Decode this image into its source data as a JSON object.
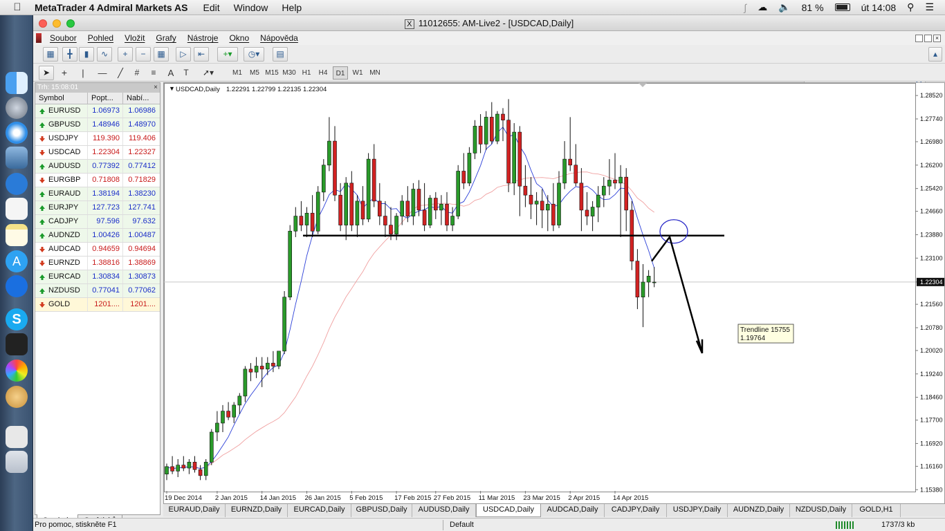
{
  "os_menubar": {
    "app": "MetaTrader 4 Admiral Markets AS",
    "menus": [
      "Edit",
      "Window",
      "Help"
    ],
    "battery": "81 %",
    "clock": "út 14:08"
  },
  "window": {
    "title": "11012655: AM-Live2 - [USDCAD,Daily]"
  },
  "menu": [
    "Soubor",
    "Pohled",
    "Vložit",
    "Grafy",
    "Nástroje",
    "Okno",
    "Nápověda"
  ],
  "timeframes": [
    "M1",
    "M5",
    "M15",
    "M30",
    "H1",
    "H4",
    "D1",
    "W1",
    "MN"
  ],
  "active_timeframe": "D1",
  "market_watch": {
    "header": "Trh: 15:08:01",
    "columns": [
      "Symbol",
      "Popt...",
      "Nabí..."
    ],
    "rows": [
      {
        "symbol": "EURUSD",
        "bid": "1.06973",
        "ask": "1.06986",
        "dir": "up"
      },
      {
        "symbol": "GBPUSD",
        "bid": "1.48946",
        "ask": "1.48970",
        "dir": "up"
      },
      {
        "symbol": "USDJPY",
        "bid": "119.390",
        "ask": "119.406",
        "dir": "down"
      },
      {
        "symbol": "USDCAD",
        "bid": "1.22304",
        "ask": "1.22327",
        "dir": "down"
      },
      {
        "symbol": "AUDUSD",
        "bid": "0.77392",
        "ask": "0.77412",
        "dir": "up"
      },
      {
        "symbol": "EURGBP",
        "bid": "0.71808",
        "ask": "0.71829",
        "dir": "down"
      },
      {
        "symbol": "EURAUD",
        "bid": "1.38194",
        "ask": "1.38230",
        "dir": "up"
      },
      {
        "symbol": "EURJPY",
        "bid": "127.723",
        "ask": "127.741",
        "dir": "up"
      },
      {
        "symbol": "CADJPY",
        "bid": "97.596",
        "ask": "97.632",
        "dir": "up"
      },
      {
        "symbol": "AUDNZD",
        "bid": "1.00426",
        "ask": "1.00487",
        "dir": "up"
      },
      {
        "symbol": "AUDCAD",
        "bid": "0.94659",
        "ask": "0.94694",
        "dir": "down"
      },
      {
        "symbol": "EURNZD",
        "bid": "1.38816",
        "ask": "1.38869",
        "dir": "down"
      },
      {
        "symbol": "EURCAD",
        "bid": "1.30834",
        "ask": "1.30873",
        "dir": "up"
      },
      {
        "symbol": "NZDUSD",
        "bid": "0.77041",
        "ask": "0.77062",
        "dir": "up"
      },
      {
        "symbol": "GOLD",
        "bid": "1201....",
        "ask": "1201....",
        "dir": "down"
      }
    ],
    "tabs": [
      "Symboly",
      "Graf ticků"
    ]
  },
  "chart_data": {
    "type": "candlestick",
    "title": "USDCAD,Daily",
    "ohlc_header": "1.22291 1.22799 1.22135 1.22304",
    "y_ticks": [
      "1.28520",
      "1.27740",
      "1.26980",
      "1.26200",
      "1.25420",
      "1.24660",
      "1.23880",
      "1.23100",
      "1.22304",
      "1.21560",
      "1.20780",
      "1.20020",
      "1.19240",
      "1.18460",
      "1.17700",
      "1.16920",
      "1.16160",
      "1.15380"
    ],
    "ylim": [
      1.1534,
      1.288
    ],
    "current_price": "1.22304",
    "x_ticks": [
      "19 Dec 2014",
      "2 Jan 2015",
      "14 Jan 2015",
      "26 Jan 2015",
      "5 Feb 2015",
      "17 Feb 2015",
      "27 Feb 2015",
      "11 Mar 2015",
      "23 Mar 2015",
      "2 Apr 2015",
      "14 Apr 2015"
    ],
    "candles": [
      [
        1.159,
        1.1625,
        1.157,
        1.1615
      ],
      [
        1.1615,
        1.165,
        1.159,
        1.16
      ],
      [
        1.16,
        1.164,
        1.158,
        1.162
      ],
      [
        1.162,
        1.165,
        1.16,
        1.161
      ],
      [
        1.161,
        1.164,
        1.159,
        1.163
      ],
      [
        1.163,
        1.165,
        1.1595,
        1.1605
      ],
      [
        1.1605,
        1.162,
        1.157,
        1.1585
      ],
      [
        1.1585,
        1.164,
        1.157,
        1.163
      ],
      [
        1.163,
        1.174,
        1.162,
        1.173
      ],
      [
        1.173,
        1.18,
        1.17,
        1.176
      ],
      [
        1.176,
        1.182,
        1.173,
        1.18
      ],
      [
        1.18,
        1.183,
        1.177,
        1.178
      ],
      [
        1.178,
        1.183,
        1.176,
        1.182
      ],
      [
        1.182,
        1.186,
        1.179,
        1.185
      ],
      [
        1.185,
        1.195,
        1.183,
        1.194
      ],
      [
        1.194,
        1.196,
        1.19,
        1.193
      ],
      [
        1.193,
        1.198,
        1.191,
        1.195
      ],
      [
        1.195,
        1.198,
        1.188,
        1.194
      ],
      [
        1.194,
        1.198,
        1.192,
        1.196
      ],
      [
        1.196,
        1.2,
        1.193,
        1.195
      ],
      [
        1.195,
        1.2,
        1.194,
        1.2
      ],
      [
        1.2,
        1.22,
        1.199,
        1.218
      ],
      [
        1.218,
        1.242,
        1.217,
        1.24
      ],
      [
        1.24,
        1.248,
        1.238,
        1.245
      ],
      [
        1.245,
        1.25,
        1.24,
        1.242
      ],
      [
        1.242,
        1.248,
        1.238,
        1.246
      ],
      [
        1.246,
        1.252,
        1.238,
        1.24
      ],
      [
        1.24,
        1.255,
        1.239,
        1.253
      ],
      [
        1.253,
        1.264,
        1.25,
        1.262
      ],
      [
        1.262,
        1.278,
        1.26,
        1.27
      ],
      [
        1.27,
        1.275,
        1.25,
        1.252
      ],
      [
        1.252,
        1.256,
        1.24,
        1.242
      ],
      [
        1.242,
        1.258,
        1.237,
        1.256
      ],
      [
        1.256,
        1.26,
        1.24,
        1.242
      ],
      [
        1.242,
        1.252,
        1.238,
        1.25
      ],
      [
        1.25,
        1.255,
        1.242,
        1.244
      ],
      [
        1.244,
        1.266,
        1.243,
        1.264
      ],
      [
        1.264,
        1.269,
        1.248,
        1.25
      ],
      [
        1.25,
        1.256,
        1.242,
        1.245
      ],
      [
        1.245,
        1.25,
        1.238,
        1.242
      ],
      [
        1.242,
        1.248,
        1.237,
        1.239
      ],
      [
        1.239,
        1.246,
        1.237,
        1.245
      ],
      [
        1.245,
        1.252,
        1.242,
        1.25
      ],
      [
        1.25,
        1.255,
        1.243,
        1.245
      ],
      [
        1.245,
        1.256,
        1.242,
        1.254
      ],
      [
        1.254,
        1.257,
        1.245,
        1.247
      ],
      [
        1.247,
        1.256,
        1.24,
        1.242
      ],
      [
        1.242,
        1.252,
        1.241,
        1.251
      ],
      [
        1.251,
        1.253,
        1.244,
        1.247
      ],
      [
        1.247,
        1.252,
        1.242,
        1.249
      ],
      [
        1.249,
        1.253,
        1.24,
        1.242
      ],
      [
        1.242,
        1.248,
        1.24,
        1.245
      ],
      [
        1.245,
        1.262,
        1.244,
        1.26
      ],
      [
        1.26,
        1.266,
        1.254,
        1.256
      ],
      [
        1.256,
        1.268,
        1.255,
        1.266
      ],
      [
        1.266,
        1.277,
        1.264,
        1.275
      ],
      [
        1.275,
        1.279,
        1.266,
        1.269
      ],
      [
        1.269,
        1.28,
        1.267,
        1.278
      ],
      [
        1.278,
        1.283,
        1.269,
        1.27
      ],
      [
        1.27,
        1.28,
        1.269,
        1.279
      ],
      [
        1.279,
        1.281,
        1.27,
        1.277
      ],
      [
        1.277,
        1.284,
        1.253,
        1.256
      ],
      [
        1.256,
        1.276,
        1.252,
        1.273
      ],
      [
        1.273,
        1.275,
        1.245,
        1.255
      ],
      [
        1.255,
        1.262,
        1.248,
        1.252
      ],
      [
        1.252,
        1.258,
        1.244,
        1.249
      ],
      [
        1.249,
        1.253,
        1.242,
        1.25
      ],
      [
        1.25,
        1.254,
        1.241,
        1.247
      ],
      [
        1.247,
        1.252,
        1.24,
        1.249
      ],
      [
        1.249,
        1.256,
        1.24,
        1.242
      ],
      [
        1.242,
        1.26,
        1.241,
        1.256
      ],
      [
        1.256,
        1.27,
        1.254,
        1.264
      ],
      [
        1.264,
        1.278,
        1.26,
        1.262
      ],
      [
        1.262,
        1.269,
        1.255,
        1.256
      ],
      [
        1.256,
        1.261,
        1.24,
        1.247
      ],
      [
        1.247,
        1.253,
        1.242,
        1.245
      ],
      [
        1.245,
        1.25,
        1.24,
        1.248
      ],
      [
        1.248,
        1.255,
        1.243,
        1.252
      ],
      [
        1.252,
        1.258,
        1.248,
        1.255
      ],
      [
        1.255,
        1.264,
        1.252,
        1.257
      ],
      [
        1.257,
        1.266,
        1.254,
        1.256
      ],
      [
        1.256,
        1.262,
        1.238,
        1.258
      ],
      [
        1.258,
        1.261,
        1.24,
        1.247
      ],
      [
        1.247,
        1.25,
        1.227,
        1.23
      ],
      [
        1.23,
        1.234,
        1.214,
        1.218
      ],
      [
        1.218,
        1.229,
        1.208,
        1.223
      ],
      [
        1.223,
        1.227,
        1.218,
        1.225
      ],
      [
        1.2229,
        1.228,
        1.2213,
        1.223
      ]
    ],
    "indicators": [
      "fast moving average (blue)",
      "slow moving average (red)"
    ],
    "trendline_label": [
      "Trendline 15755",
      "1.19764"
    ]
  },
  "chart_tabs": [
    "EURAUD,Daily",
    "EURNZD,Daily",
    "EURCAD,Daily",
    "GBPUSD,Daily",
    "AUDUSD,Daily",
    "USDCAD,Daily",
    "AUDCAD,Daily",
    "CADJPY,Daily",
    "USDJPY,Daily",
    "AUDNZD,Daily",
    "NZDUSD,Daily",
    "GOLD,H1"
  ],
  "active_chart_tab": "USDCAD,Daily",
  "status": {
    "help": "Pro pomoc, stiskněte F1",
    "profile": "Default",
    "traffic": "1737/3 kb"
  },
  "colors": {
    "up_arrow": "#1a9a2a",
    "down_arrow": "#d23a1e",
    "bull_candle": "#2a9a2a",
    "bear_candle": "#d22222",
    "ma_fast": "#2b3fd8",
    "ma_slow": "#f0a0a0"
  }
}
